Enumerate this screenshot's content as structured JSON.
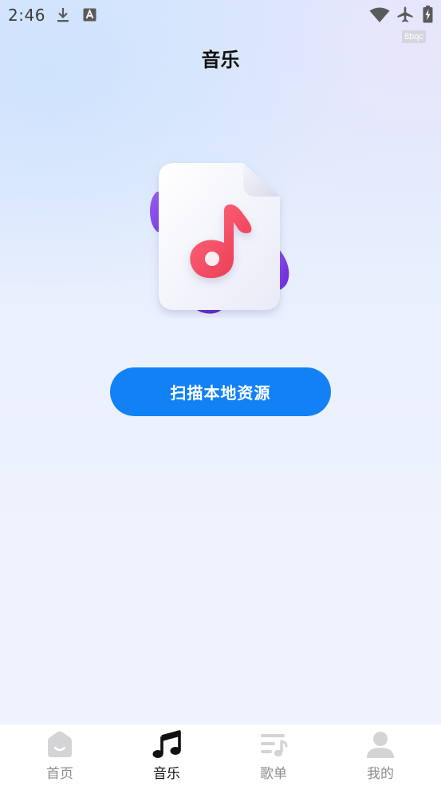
{
  "status_bar": {
    "time": "2:46",
    "icons": [
      "download-icon",
      "text-a-icon",
      "wifi-icon",
      "airplane-mode-icon",
      "battery-charging-icon"
    ],
    "corner_badge": "8bqc"
  },
  "header": {
    "title": "音乐"
  },
  "main": {
    "illustration": "music-file-icon",
    "scan_button_label": "扫描本地资源"
  },
  "colors": {
    "accent": "#1281f6",
    "note": "#f0465c",
    "active_tab": "#111111",
    "inactive_tab": "#8d8d92"
  },
  "bottom_nav": {
    "active_index": 1,
    "items": [
      {
        "label": "首页",
        "icon": "home-icon"
      },
      {
        "label": "音乐",
        "icon": "music-note-icon"
      },
      {
        "label": "歌单",
        "icon": "playlist-icon"
      },
      {
        "label": "我的",
        "icon": "profile-icon"
      }
    ]
  }
}
